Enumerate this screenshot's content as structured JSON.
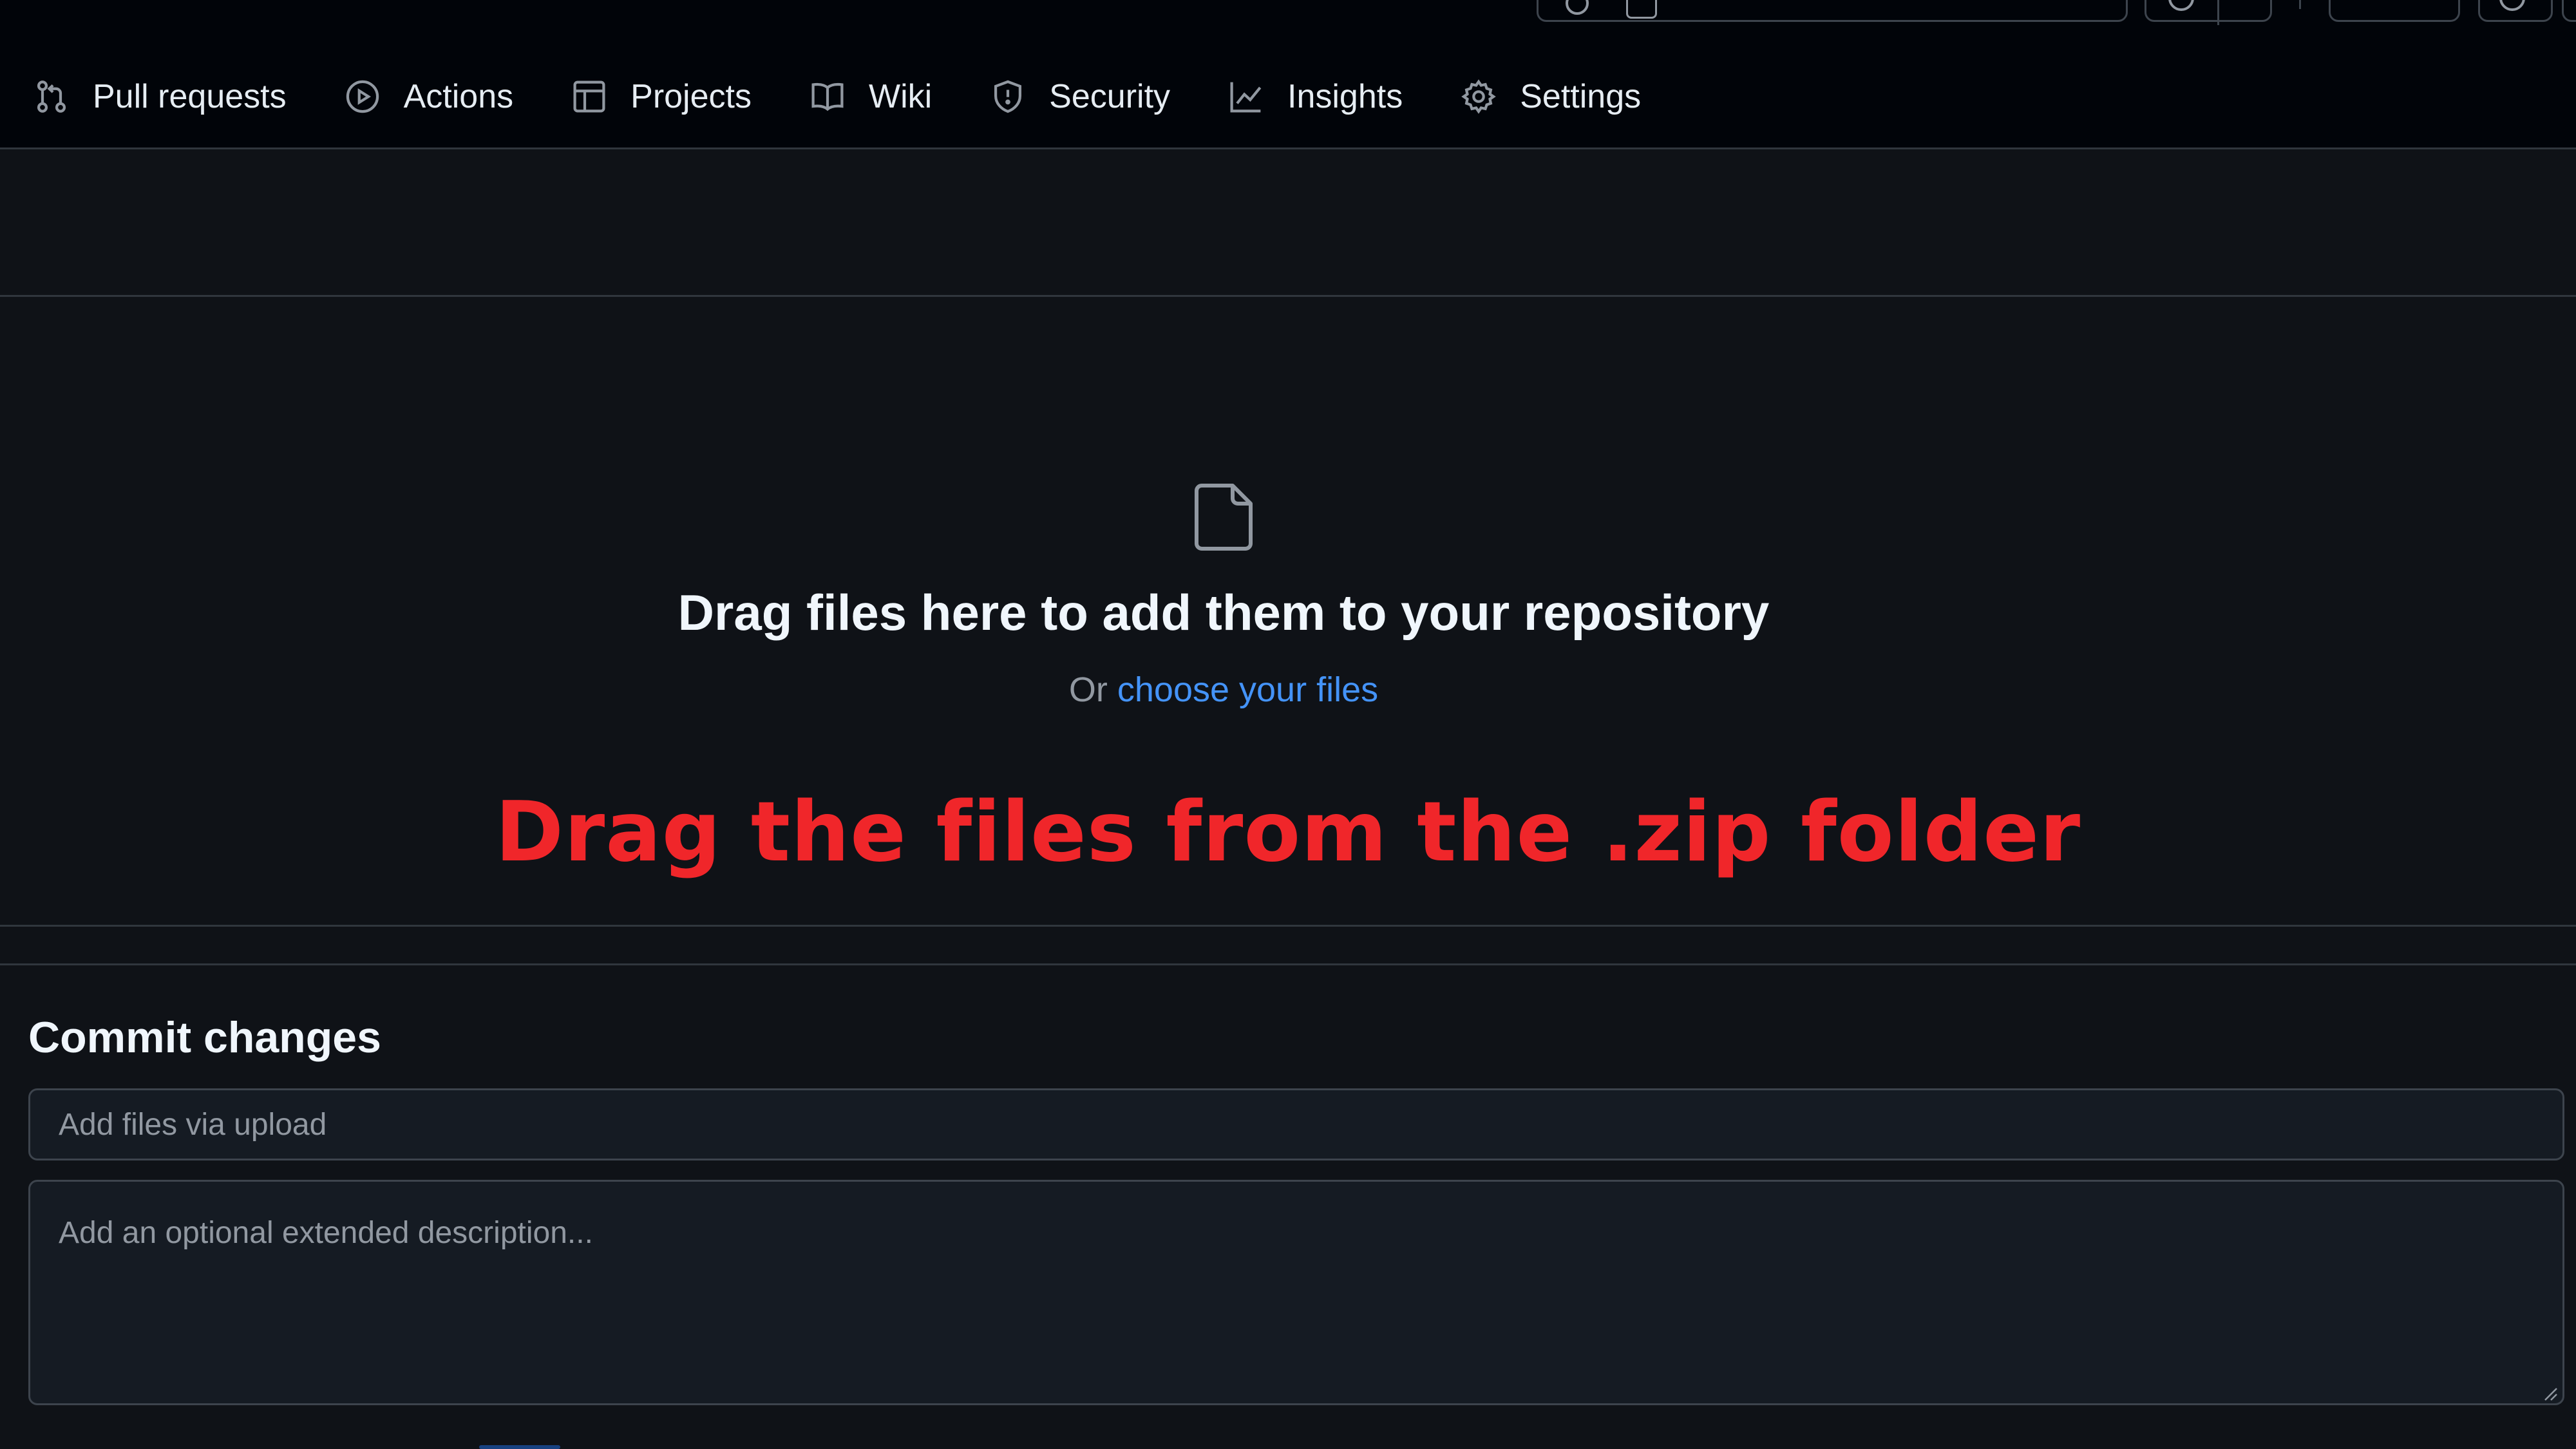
{
  "nav": {
    "items": [
      {
        "label": "Pull requests",
        "icon": "pull-request-icon"
      },
      {
        "label": "Actions",
        "icon": "play-circle-icon"
      },
      {
        "label": "Projects",
        "icon": "table-icon"
      },
      {
        "label": "Wiki",
        "icon": "book-icon"
      },
      {
        "label": "Security",
        "icon": "shield-icon"
      },
      {
        "label": "Insights",
        "icon": "graph-icon"
      },
      {
        "label": "Settings",
        "icon": "gear-icon"
      }
    ]
  },
  "drop_zone": {
    "title": "Drag files here to add them to your repository",
    "or_text": "Or ",
    "choose_link": "choose your files",
    "icon": "file-icon"
  },
  "annotation": {
    "text": "Drag the files from the .zip folder",
    "color": "#f0262a"
  },
  "commit": {
    "heading": "Commit changes",
    "message_placeholder": "Add files via upload",
    "description_placeholder": "Add an optional extended description..."
  },
  "colors": {
    "background": "#0f1217",
    "header_bg": "#010409",
    "link": "#4493f8",
    "border": "#30363d"
  }
}
